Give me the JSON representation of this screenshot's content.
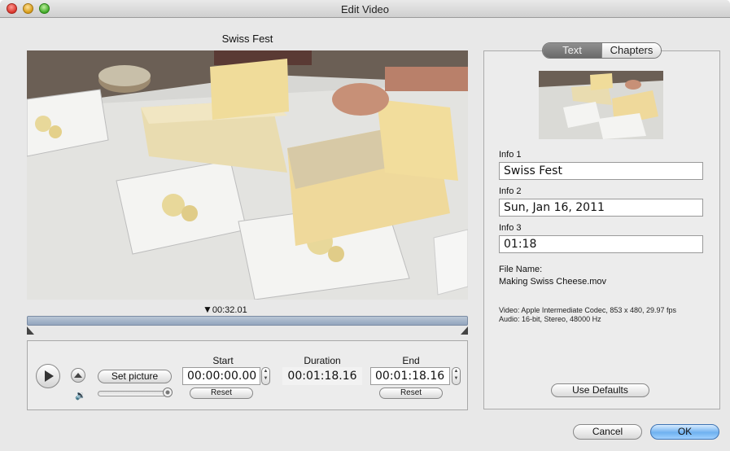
{
  "window": {
    "title": "Edit Video"
  },
  "video": {
    "title": "Swiss Fest",
    "playhead_time": "00:32.01"
  },
  "controls": {
    "set_picture_label": "Set picture",
    "start": {
      "label": "Start",
      "value": "00:00:00.00",
      "reset_label": "Reset"
    },
    "duration": {
      "label": "Duration",
      "value": "00:01:18.16"
    },
    "end": {
      "label": "End",
      "value": "00:01:18.16",
      "reset_label": "Reset"
    },
    "volume_level": 0.95
  },
  "panel": {
    "tabs": [
      {
        "label": "Text",
        "selected": true
      },
      {
        "label": "Chapters",
        "selected": false
      }
    ],
    "info1": {
      "label": "Info 1",
      "value": "Swiss Fest"
    },
    "info2": {
      "label": "Info 2",
      "value": "Sun, Jan 16, 2011"
    },
    "info3": {
      "label": "Info 3",
      "value": "01:18"
    },
    "file_name_label": "File Name:",
    "file_name": "Making Swiss Cheese.mov",
    "video_info": "Video: Apple Intermediate Codec, 853 x 480, 29.97 fps",
    "audio_info": "Audio: 16-bit, Stereo, 48000 Hz",
    "use_defaults_label": "Use Defaults"
  },
  "footer": {
    "cancel_label": "Cancel",
    "ok_label": "OK"
  },
  "colors": {
    "accent_button": "#6fb1f0",
    "scrubber": "#93a5bd"
  },
  "icons": [
    "close-icon",
    "minimize-icon",
    "zoom-icon",
    "play-icon",
    "eject-icon",
    "speaker-icon",
    "playhead-icon"
  ]
}
